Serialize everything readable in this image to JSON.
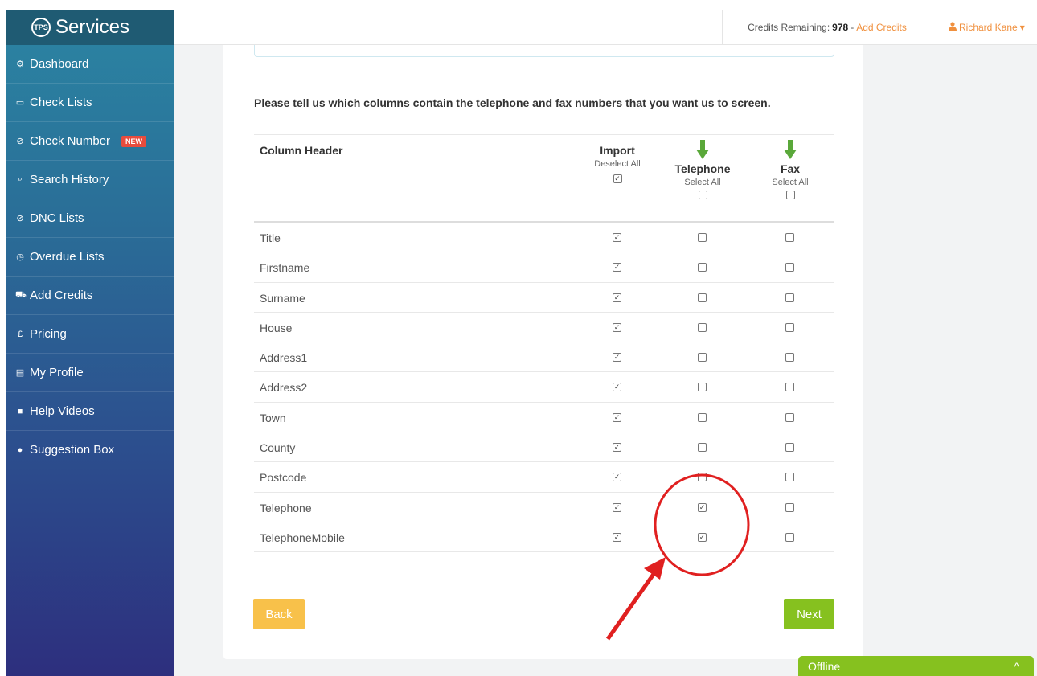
{
  "brand": {
    "logo_text": "TPS",
    "name": "Services"
  },
  "sidebar": {
    "items": [
      {
        "label": "Dashboard",
        "icon": "cogs-icon",
        "glyph": "⚙"
      },
      {
        "label": "Check Lists",
        "icon": "folder-open-icon",
        "glyph": "▭"
      },
      {
        "label": "Check Number",
        "icon": "check-circle-icon",
        "glyph": "⊘",
        "badge": "NEW"
      },
      {
        "label": "Search History",
        "icon": "search-icon",
        "glyph": "⌕"
      },
      {
        "label": "DNC Lists",
        "icon": "ban-icon",
        "glyph": "⊘"
      },
      {
        "label": "Overdue Lists",
        "icon": "clock-icon",
        "glyph": "◷"
      },
      {
        "label": "Add Credits",
        "icon": "cart-icon",
        "glyph": "⛟"
      },
      {
        "label": "Pricing",
        "icon": "pound-icon",
        "glyph": "£"
      },
      {
        "label": "My Profile",
        "icon": "id-card-icon",
        "glyph": "▤"
      },
      {
        "label": "Help Videos",
        "icon": "video-icon",
        "glyph": "■"
      },
      {
        "label": "Suggestion Box",
        "icon": "comment-icon",
        "glyph": "●"
      }
    ]
  },
  "topbar": {
    "credits_label": "Credits Remaining:",
    "credits_value": "978",
    "separator": "-",
    "add_credits": "Add Credits",
    "user_name": "Richard Kane",
    "user_caret": "▾"
  },
  "instruction": "Please tell us which columns contain the telephone and fax numbers that you want us to screen.",
  "table": {
    "column_header": "Column Header",
    "import": {
      "title": "Import",
      "action": "Deselect All",
      "checked": true
    },
    "telephone": {
      "title": "Telephone",
      "action": "Select All",
      "checked": false
    },
    "fax": {
      "title": "Fax",
      "action": "Select All",
      "checked": false
    },
    "rows": [
      {
        "name": "Title",
        "import": true,
        "telephone": false,
        "fax": false
      },
      {
        "name": "Firstname",
        "import": true,
        "telephone": false,
        "fax": false
      },
      {
        "name": "Surname",
        "import": true,
        "telephone": false,
        "fax": false
      },
      {
        "name": "House",
        "import": true,
        "telephone": false,
        "fax": false
      },
      {
        "name": "Address1",
        "import": true,
        "telephone": false,
        "fax": false
      },
      {
        "name": "Address2",
        "import": true,
        "telephone": false,
        "fax": false
      },
      {
        "name": "Town",
        "import": true,
        "telephone": false,
        "fax": false
      },
      {
        "name": "County",
        "import": true,
        "telephone": false,
        "fax": false
      },
      {
        "name": "Postcode",
        "import": true,
        "telephone": false,
        "fax": false
      },
      {
        "name": "Telephone",
        "import": true,
        "telephone": true,
        "fax": false
      },
      {
        "name": "TelephoneMobile",
        "import": true,
        "telephone": true,
        "fax": false
      }
    ]
  },
  "buttons": {
    "back": "Back",
    "next": "Next"
  },
  "chat": {
    "status": "Offline",
    "caret": "^"
  },
  "colors": {
    "accent_orange": "#f0903e",
    "back_button": "#f8c14a",
    "next_button": "#86c11f",
    "arrow_green": "#5aa83a",
    "annotation_red": "#e02020"
  }
}
